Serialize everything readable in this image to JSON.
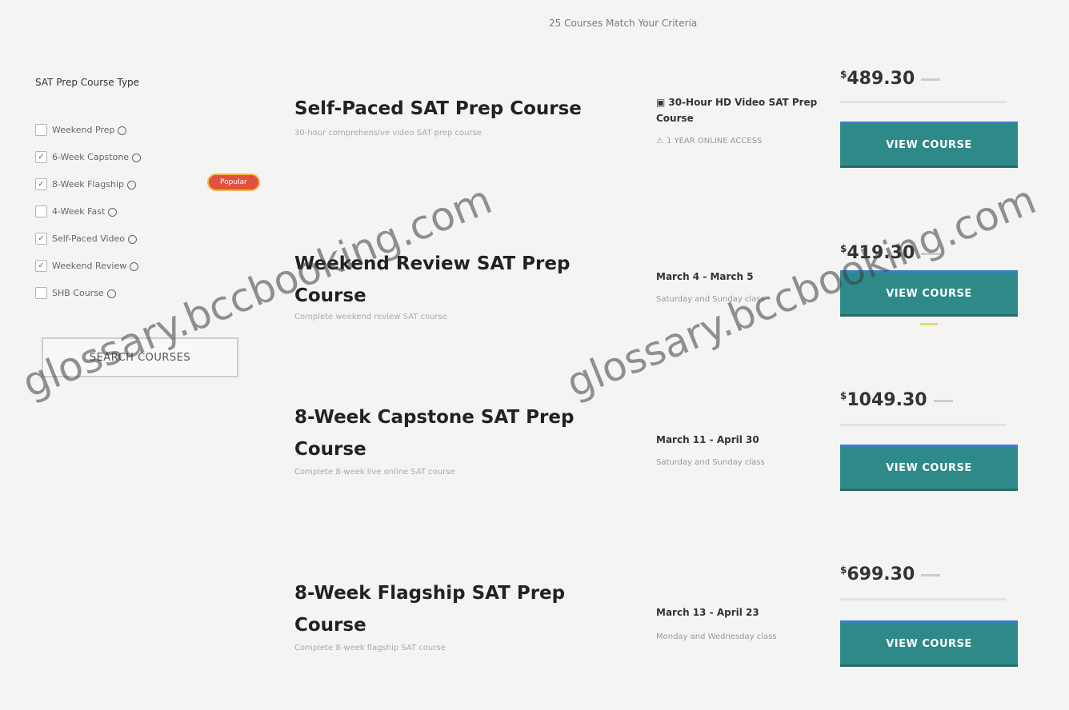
{
  "results_count": "25 Courses Match Your Criteria",
  "filters": {
    "heading": "SAT Prep Course Type",
    "options": [
      {
        "label": "Weekend Prep",
        "checked": false
      },
      {
        "label": "6-Week Capstone",
        "checked": true
      },
      {
        "label": "8-Week Flagship",
        "checked": true,
        "badge": "Popular"
      },
      {
        "label": "4-Week Fast",
        "checked": false
      },
      {
        "label": "Self-Paced Video",
        "checked": true
      },
      {
        "label": "Weekend Review",
        "checked": true
      },
      {
        "label": "SHB Course",
        "checked": false
      }
    ],
    "search_label": "SEARCH COURSES"
  },
  "courses": [
    {
      "title": "Self-Paced SAT Prep Course",
      "description": "30-hour comprehensive video SAT prep course",
      "detail": "30-Hour HD Video SAT Prep Course",
      "detail_icon": "video-icon",
      "sub": "1 YEAR ONLINE ACCESS",
      "sub_icon": "warning-icon",
      "price": "489.30",
      "currency": "$",
      "button": "VIEW COURSE"
    },
    {
      "title": "Weekend Review SAT Prep Course",
      "description": "Complete weekend review SAT course",
      "detail": "March 4 - March 5",
      "sub": "Saturday and Sunday class",
      "price": "419.30",
      "currency": "$",
      "button": "VIEW COURSE"
    },
    {
      "title": "8-Week Capstone SAT Prep Course",
      "description": "Complete 8-week live online SAT course",
      "detail": "March 11 - April 30",
      "sub": "Saturday and Sunday class",
      "price": "1049.30",
      "currency": "$",
      "button": "VIEW COURSE"
    },
    {
      "title": "8-Week Flagship SAT Prep Course",
      "description": "Complete 8-week flagship SAT course",
      "detail": "March 13 - April 23",
      "sub": "Monday and Wednesday class",
      "price": "699.30",
      "currency": "$",
      "button": "VIEW COURSE"
    }
  ],
  "watermark": "glossary.bccbooking.com"
}
